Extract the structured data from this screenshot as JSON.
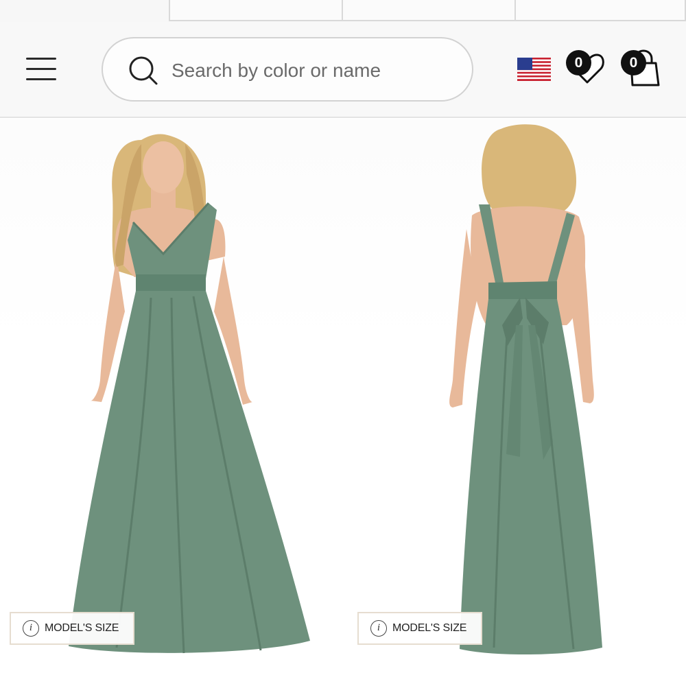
{
  "header": {
    "search": {
      "placeholder": "Search by color or name",
      "value": ""
    },
    "wishlist": {
      "count": "0"
    },
    "cart": {
      "count": "0"
    }
  },
  "gallery": {
    "images": [
      {
        "view": "front",
        "model_size_label": "MODEL'S SIZE"
      },
      {
        "view": "back",
        "model_size_label": "MODEL'S SIZE"
      }
    ]
  },
  "colors": {
    "dress": "#6e917d",
    "dress_shadow": "#5c7d6a",
    "skin": "#e8b99a",
    "hair": "#d9b779"
  }
}
